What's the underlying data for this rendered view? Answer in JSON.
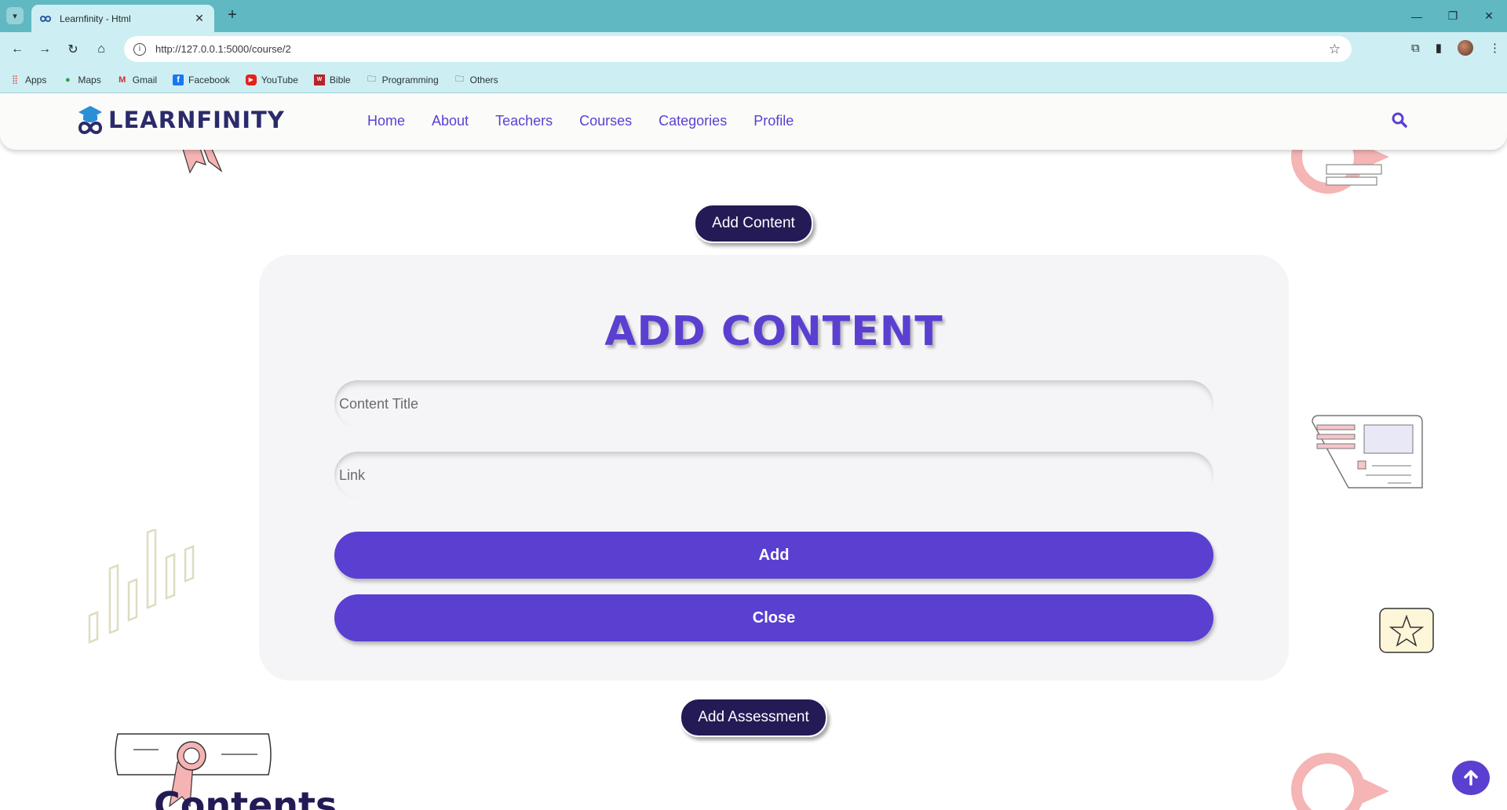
{
  "browser": {
    "tab_title": "Learnfinity - Html",
    "url": "http://127.0.0.1:5000/course/2",
    "bookmarks": [
      {
        "label": "Apps",
        "icon": "apps-grid-icon"
      },
      {
        "label": "Maps",
        "icon": "maps-pin-icon"
      },
      {
        "label": "Gmail",
        "icon": "gmail-icon"
      },
      {
        "label": "Facebook",
        "icon": "facebook-icon"
      },
      {
        "label": "YouTube",
        "icon": "youtube-icon"
      },
      {
        "label": "Bible",
        "icon": "bible-icon"
      },
      {
        "label": "Programming",
        "icon": "folder-icon"
      },
      {
        "label": "Others",
        "icon": "folder-icon"
      }
    ]
  },
  "site": {
    "logo_text": "LEARNFINITY",
    "nav": [
      "Home",
      "About",
      "Teachers",
      "Courses",
      "Categories",
      "Profile"
    ]
  },
  "main": {
    "add_content_button": "Add Content",
    "add_assessment_button": "Add Assessment",
    "form": {
      "title": "ADD CONTENT",
      "content_title_placeholder": "Content Title",
      "link_placeholder": "Link",
      "add_button": "Add",
      "close_button": "Close"
    },
    "contents_heading": "Contents"
  },
  "colors": {
    "accent": "#5b3fd1",
    "dark_button": "#241a55",
    "browser_frame": "#5fb8c2",
    "toolbar": "#cdeef2"
  }
}
